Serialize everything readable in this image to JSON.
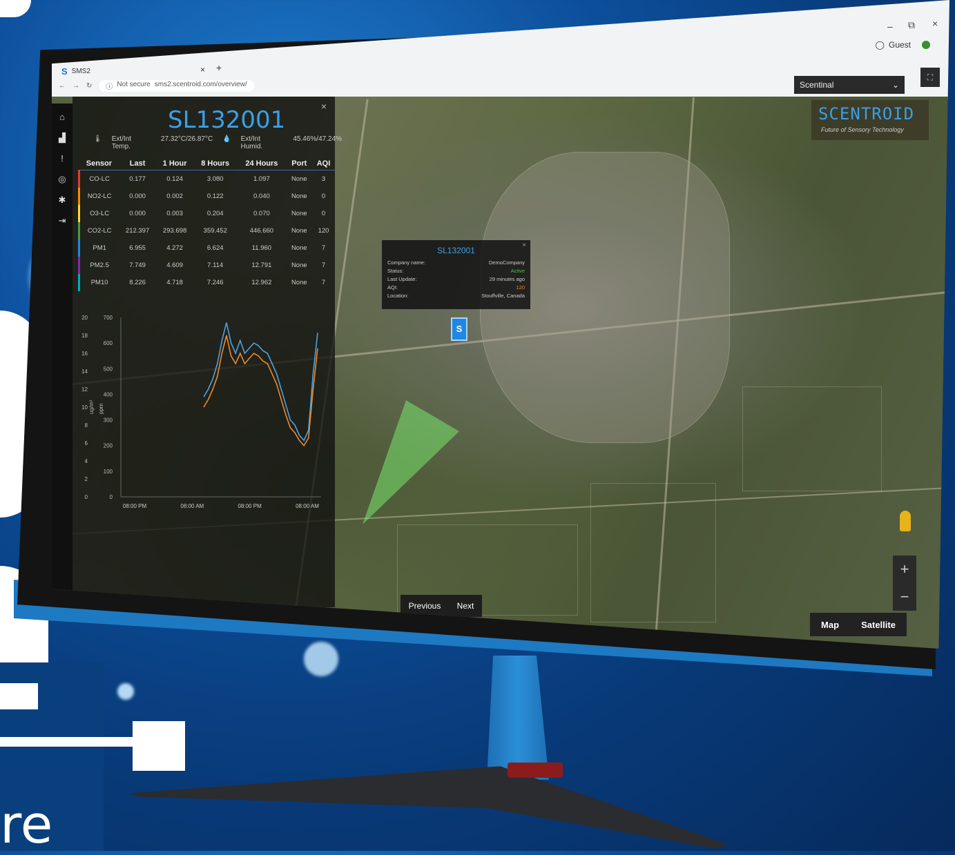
{
  "browser": {
    "tab_title": "SMS2",
    "tab_icon": "S",
    "tab_close": "×",
    "tab_new": "+",
    "address_security": "Not secure",
    "address_url": "sms2.scentroid.com/overview/",
    "profile_label": "Guest",
    "window_minimize": "–",
    "window_restore": "⧉",
    "window_close": "×"
  },
  "sidebar": {
    "items": [
      {
        "icon": "home-icon",
        "glyph": "⌂"
      },
      {
        "icon": "chart-icon",
        "glyph": "▟"
      },
      {
        "icon": "alert-icon",
        "glyph": "!"
      },
      {
        "icon": "target-icon",
        "glyph": "◎"
      },
      {
        "icon": "settings-icon",
        "glyph": "✱"
      },
      {
        "icon": "logout-icon",
        "glyph": "⇥"
      }
    ]
  },
  "panel": {
    "title": "SL132001",
    "close": "×",
    "temp_label": "Ext/Int Temp.",
    "temp_value": "27.32°C/26.87°C",
    "humid_label": "Ext/Int Humid.",
    "humid_value": "45.46%/47.24%",
    "columns": [
      "Sensor",
      "Last",
      "1 Hour",
      "8 Hours",
      "24 Hours",
      "Port",
      "AQI"
    ],
    "rows": [
      {
        "sensor": "CO-LC",
        "last": "0.177",
        "h1": "0.124",
        "h8": "3.080",
        "h24": "1.097",
        "port": "None",
        "aqi": "3",
        "color": "#e53935"
      },
      {
        "sensor": "NO2-LC",
        "last": "0.000",
        "h1": "0.002",
        "h8": "0.122",
        "h24": "0.040",
        "port": "None",
        "aqi": "0",
        "color": "#fb8c00"
      },
      {
        "sensor": "O3-LC",
        "last": "0.000",
        "h1": "0.003",
        "h8": "0.204",
        "h24": "0.070",
        "port": "None",
        "aqi": "0",
        "color": "#fdd835"
      },
      {
        "sensor": "CO2-LC",
        "last": "212.397",
        "h1": "293.698",
        "h8": "359.452",
        "h24": "446.660",
        "port": "None",
        "aqi": "120",
        "color": "#43a047"
      },
      {
        "sensor": "PM1",
        "last": "6.955",
        "h1": "4.272",
        "h8": "6.624",
        "h24": "11.960",
        "port": "None",
        "aqi": "7",
        "color": "#1e88e5"
      },
      {
        "sensor": "PM2.5",
        "last": "7.749",
        "h1": "4.609",
        "h8": "7.114",
        "h24": "12.791",
        "port": "None",
        "aqi": "7",
        "color": "#8e24aa"
      },
      {
        "sensor": "PM10",
        "last": "8.226",
        "h1": "4.718",
        "h8": "7.246",
        "h24": "12.962",
        "port": "None",
        "aqi": "7",
        "color": "#00acc1"
      }
    ]
  },
  "chart_data": {
    "type": "line",
    "xlabel": "",
    "ylabel_left": "ug/m³",
    "ylabel_right": "ppm",
    "x_ticks": [
      "08:00 PM",
      "08:00 AM",
      "08:00 PM",
      "08:00 AM"
    ],
    "y_left_ticks": [
      0,
      2,
      4,
      6,
      8,
      10,
      12,
      14,
      16,
      18,
      20
    ],
    "y_right_ticks": [
      0,
      100,
      200,
      300,
      400,
      500,
      600,
      700
    ],
    "ylim_left": [
      0,
      20
    ],
    "ylim_right": [
      0,
      700
    ],
    "series": [
      {
        "color": "#4fa3e0",
        "values": [
          390,
          420,
          460,
          520,
          610,
          680,
          600,
          560,
          610,
          560,
          580,
          600,
          590,
          570,
          560,
          520,
          480,
          420,
          360,
          300,
          280,
          240,
          220,
          260,
          480,
          640
        ]
      },
      {
        "color": "#f08a2a",
        "values": [
          350,
          380,
          420,
          470,
          560,
          630,
          550,
          520,
          560,
          520,
          540,
          560,
          550,
          530,
          520,
          480,
          440,
          380,
          320,
          270,
          250,
          220,
          200,
          230,
          420,
          580
        ]
      }
    ]
  },
  "popup": {
    "title": "SL132001",
    "close": "×",
    "rows": [
      {
        "label": "Company name:",
        "value": "DemoCompany",
        "color": "#ccc"
      },
      {
        "label": "Status:",
        "value": "Active",
        "color": "#43c24a"
      },
      {
        "label": "Last Update:",
        "value": "29 minutes ago",
        "color": "#ccc"
      },
      {
        "label": "AQI:",
        "value": "120",
        "color": "#f08a2a"
      },
      {
        "label": "Location:",
        "value": "Stouffville, Canada",
        "color": "#ccc"
      }
    ]
  },
  "map": {
    "marker_label": "S",
    "site_selector": "Scentinal",
    "brand_name": "SCENTROID",
    "brand_tagline": "Future of Sensory Technology",
    "zoom_in": "+",
    "zoom_out": "−",
    "type_map": "Map",
    "type_satellite": "Satellite",
    "previous": "Previous",
    "next": "Next"
  },
  "poster": {
    "footer_text": "re"
  }
}
